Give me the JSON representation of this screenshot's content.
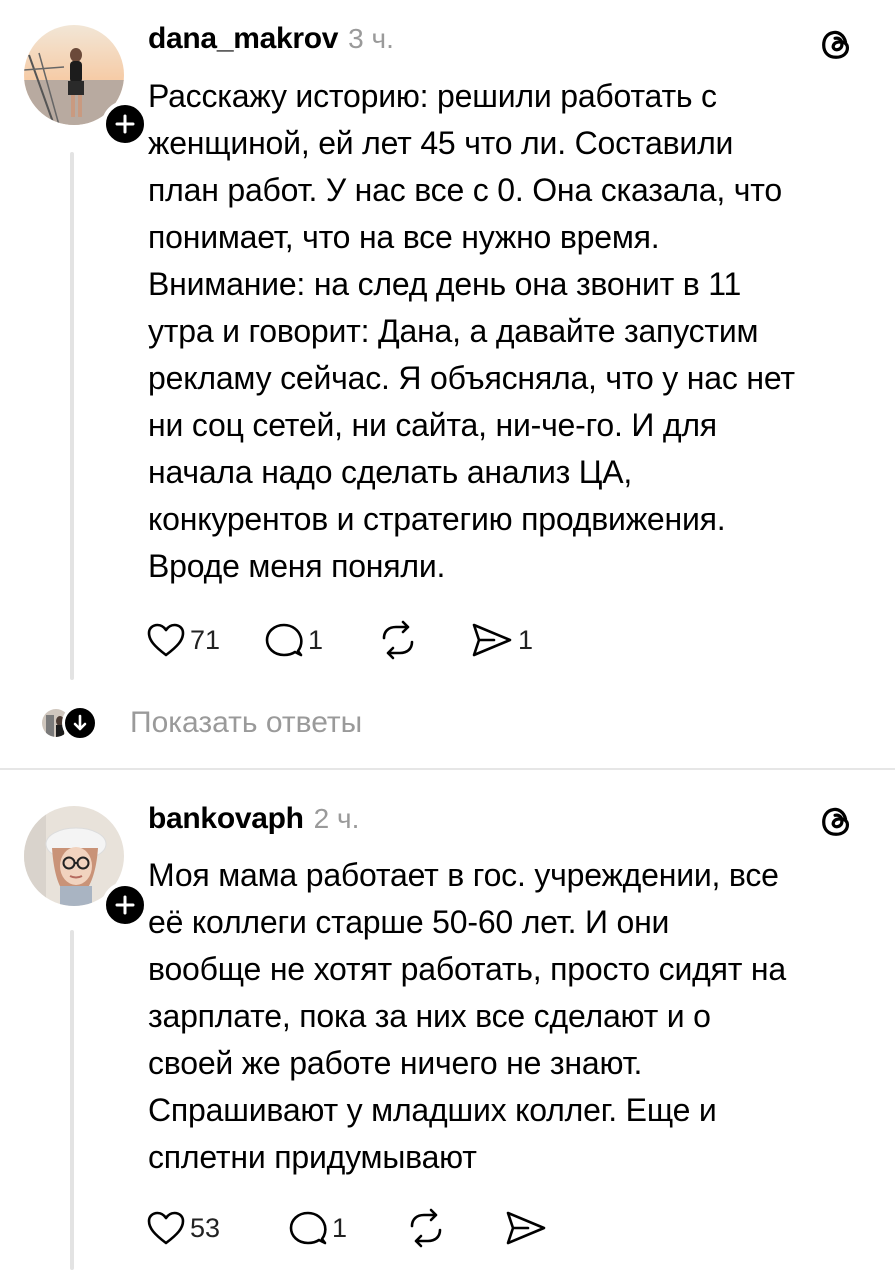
{
  "posts": [
    {
      "username": "dana_makrov",
      "time": "3 ч.",
      "avatar_icon": "profile-photo",
      "text": "Расскажу историю: решили работать с\nженщиной, ей лет 45 что ли. Составили\nплан работ. У нас все с 0. Она сказала, что\nпонимает, что на все нужно время.\nВнимание: на след день она звонит в 11\nутра и говорит: Дана, а давайте запустим\nрекламу сейчас. Я объясняла, что у нас нет\nни соц сетей, ни сайта, ни-че-го. И для\nначала надо сделать анализ ЦА,\nконкурентов и стратегию продвижения.\nВроде меня поняли.",
      "likes": "71",
      "replies": "1",
      "shares": "1"
    },
    {
      "username": "bankovaph",
      "time": "2 ч.",
      "avatar_icon": "profile-photo",
      "text": "Моя мама работает в гос. учреждении, все\nеё коллеги старше 50-60 лет. И они\nвообще не хотят работать, просто сидят на\nзарплате, пока за них все сделают и о\nсвоей же работе ничего не знают.\nСпрашивают у младших коллег. Еще и\nсплетни придумывают",
      "likes": "53",
      "replies": "1",
      "shares": ""
    }
  ],
  "show_replies_label": "Показать ответы",
  "colors": {
    "muted": "#9a9a9a",
    "line": "#e3e3e3",
    "text": "#000000"
  }
}
